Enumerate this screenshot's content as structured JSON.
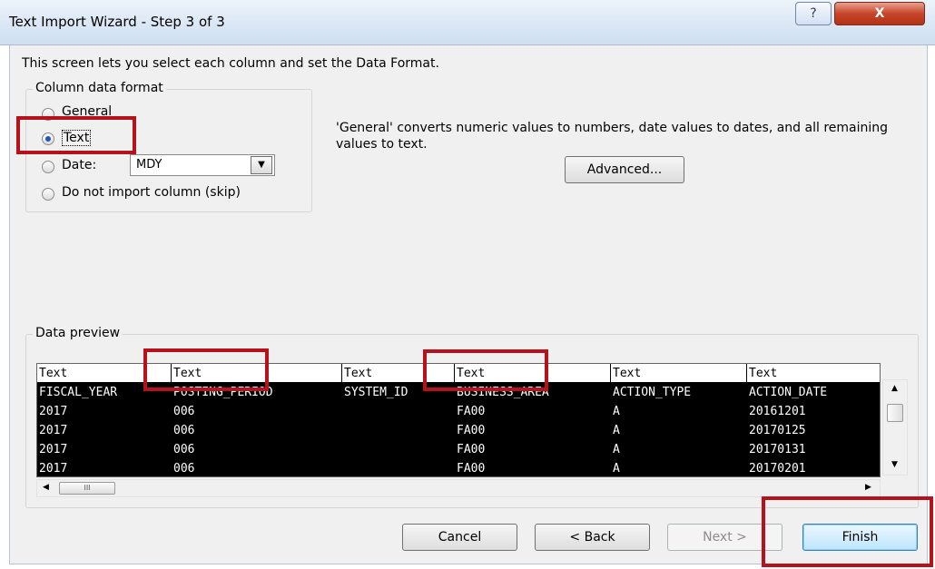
{
  "window": {
    "title": "Text Import Wizard - Step 3 of 3",
    "help_glyph": "?",
    "close_glyph": "X"
  },
  "intro_text": "This screen lets you select each column and set the Data Format.",
  "column_format": {
    "title": "Column data format",
    "options": [
      {
        "label": "General",
        "selected": false
      },
      {
        "label": "Text",
        "selected": true
      },
      {
        "label": "Date:",
        "selected": false
      },
      {
        "label": "Do not import column (skip)",
        "selected": false
      }
    ],
    "date_format": "MDY"
  },
  "general_note": "'General' converts numeric values to numbers, date values to dates, and all remaining values to text.",
  "advanced_label": "Advanced...",
  "data_preview": {
    "title": "Data preview",
    "header_row": [
      "Text",
      "Text",
      "Text",
      "Text",
      "Text",
      "Text"
    ],
    "rows": [
      [
        "FISCAL_YEAR",
        "POSTING_PERIOD",
        "SYSTEM_ID",
        "BUSINESS_AREA",
        "ACTION_TYPE",
        "ACTION_DATE"
      ],
      [
        "2017",
        "006",
        "",
        "FA00",
        "A",
        "20161201"
      ],
      [
        "2017",
        "006",
        "",
        "FA00",
        "A",
        "20170125"
      ],
      [
        "2017",
        "006",
        "",
        "FA00",
        "A",
        "20170131"
      ],
      [
        "2017",
        "006",
        "",
        "FA00",
        "A",
        "20170201"
      ]
    ]
  },
  "buttons": {
    "cancel": "Cancel",
    "back": "< Back",
    "next": "Next >",
    "finish": "Finish"
  },
  "scroll_glyphs": {
    "up": "▲",
    "down": "▼",
    "left": "◀",
    "right": "▶",
    "grip": "III"
  },
  "colors": {
    "annotation_red": "#b5121b",
    "radio_selected": "#1e57b6"
  }
}
